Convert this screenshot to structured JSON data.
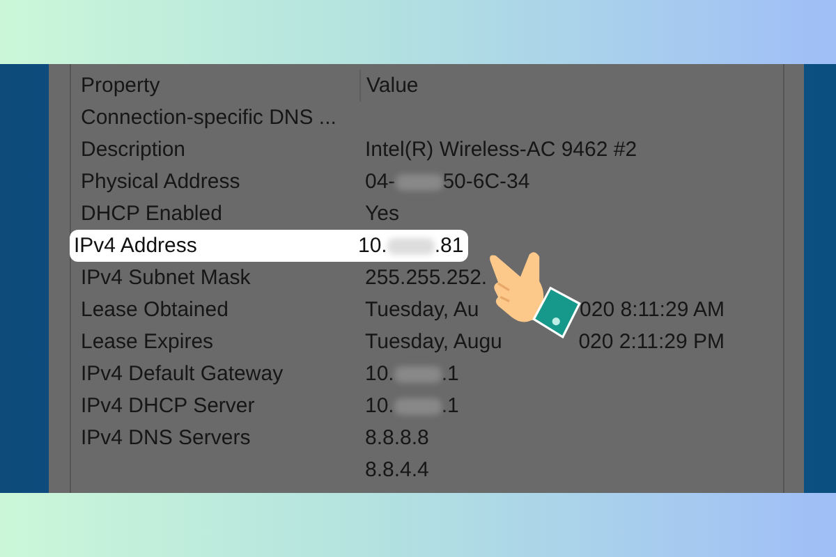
{
  "columns": [
    "Property",
    "Value"
  ],
  "rows": [
    {
      "property": "Connection-specific DNS ...",
      "value": [],
      "selected": false
    },
    {
      "property": "Description",
      "value": [
        {
          "kind": "text",
          "text": "Intel(R) Wireless-AC 9462 #2"
        }
      ],
      "selected": false
    },
    {
      "property": "Physical Address",
      "value": [
        {
          "kind": "text",
          "text": "04-"
        },
        {
          "kind": "blur"
        },
        {
          "kind": "text",
          "text": "50-6C-34"
        }
      ],
      "selected": false
    },
    {
      "property": "DHCP Enabled",
      "value": [
        {
          "kind": "text",
          "text": "Yes"
        }
      ],
      "selected": false
    },
    {
      "property": "IPv4 Address",
      "value": [
        {
          "kind": "text",
          "text": "10."
        },
        {
          "kind": "blur"
        },
        {
          "kind": "text",
          "text": ".81"
        }
      ],
      "selected": true
    },
    {
      "property": "IPv4 Subnet Mask",
      "value": [
        {
          "kind": "text",
          "text": "255.255.252."
        }
      ],
      "selected": false
    },
    {
      "property": "Lease Obtained",
      "value": [
        {
          "kind": "text",
          "text": "Tuesday, Au"
        },
        {
          "kind": "hidden"
        },
        {
          "kind": "text",
          "text": "020 8:11:29 AM"
        }
      ],
      "selected": false
    },
    {
      "property": "Lease Expires",
      "value": [
        {
          "kind": "text",
          "text": "Tuesday, Augu"
        },
        {
          "kind": "hidden"
        },
        {
          "kind": "text",
          "text": "020 2:11:29 PM"
        }
      ],
      "selected": false
    },
    {
      "property": "IPv4 Default Gateway",
      "value": [
        {
          "kind": "text",
          "text": "10."
        },
        {
          "kind": "blur"
        },
        {
          "kind": "text",
          "text": ".1"
        }
      ],
      "selected": false
    },
    {
      "property": "IPv4 DHCP Server",
      "value": [
        {
          "kind": "text",
          "text": "10."
        },
        {
          "kind": "blur"
        },
        {
          "kind": "text",
          "text": ".1"
        }
      ],
      "selected": false
    },
    {
      "property": "IPv4 DNS Servers",
      "value": [
        {
          "kind": "text",
          "text": "8.8.8.8"
        }
      ],
      "selected": false
    },
    {
      "property": "",
      "value": [
        {
          "kind": "text",
          "text": "8.8.4.4"
        }
      ],
      "selected": false
    }
  ]
}
